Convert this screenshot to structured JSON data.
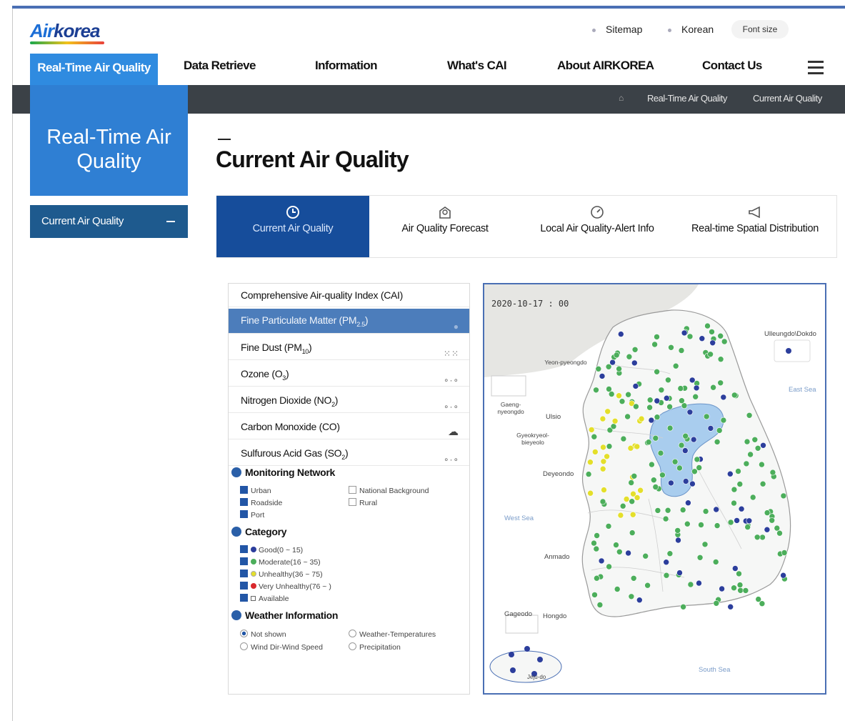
{
  "header": {
    "logo_air": "Air",
    "logo_korea": "korea",
    "sitemap": "Sitemap",
    "language": "Korean",
    "font_size": "Font size"
  },
  "nav": {
    "items": [
      "Real-Time Air Quality",
      "Data Retrieve",
      "Information",
      "What's CAI",
      "About AIRKOREA",
      "Contact Us"
    ]
  },
  "breadcrumb": [
    "Real-Time Air Quality",
    "Current Air Quality"
  ],
  "sidebar": {
    "title_line1": "Real-Time Air",
    "title_line2": "Quality",
    "item": "Current Air Quality"
  },
  "page_title": "Current Air Quality",
  "tabs": [
    {
      "label": "Current Air Quality",
      "icon": "clock-icon"
    },
    {
      "label": "Air Quality Forecast",
      "icon": "forecast-icon"
    },
    {
      "label": "Local Air Quality-Alert Info",
      "icon": "gauge-icon"
    },
    {
      "label": "Real-time Spatial Distribution",
      "icon": "megaphone-icon"
    }
  ],
  "pollutants": [
    {
      "label": "Comprehensive Air-quality Index (CAI)",
      "base": "Comprehensive Air-quality Index (CAI)",
      "sub": "",
      "tail": ""
    },
    {
      "label": "Fine Particulate Matter (PM2.5)",
      "base": "Fine Particulate Matter (PM",
      "sub": "2.5",
      "tail": ")"
    },
    {
      "label": "Fine Dust (PM10)",
      "base": "Fine Dust (PM",
      "sub": "10",
      "tail": ")"
    },
    {
      "label": "Ozone (O3)",
      "base": "Ozone (O",
      "sub": "3",
      "tail": ")"
    },
    {
      "label": "Nitrogen Dioxide (NO2)",
      "base": "Nitrogen Dioxide (NO",
      "sub": "2",
      "tail": ")"
    },
    {
      "label": "Carbon Monoxide (CO)",
      "base": "Carbon Monoxide (CO)",
      "sub": "",
      "tail": ""
    },
    {
      "label": "Sulfurous Acid Gas (SO2)",
      "base": "Sulfurous Acid Gas (SO",
      "sub": "2",
      "tail": ")"
    }
  ],
  "monitoring": {
    "title": "Monitoring Network",
    "urban": "Urban",
    "roadside": "Roadside",
    "port": "Port",
    "national_background": "National Background",
    "rural": "Rural"
  },
  "category": {
    "title": "Category",
    "good": "Good(0 ~ 15)",
    "moderate": "Moderate(16 ~ 35)",
    "unhealthy": "Unhealthy(36 ~ 75)",
    "very_unhealthy": "Very Unhealthy(76 ~ )",
    "available": "Available",
    "colors": {
      "good": "#2c3e9c",
      "moderate": "#4cae5b",
      "unhealthy": "#e4df2a",
      "very_unhealthy": "#d9282d"
    }
  },
  "weather": {
    "title": "Weather Information",
    "not_shown": "Not shown",
    "temperatures": "Weather-Temperatures",
    "wind": "Wind Dir-Wind Speed",
    "precipitation": "Precipitation"
  },
  "map": {
    "timestamp": "2020-10-17 : 00",
    "labels": {
      "ulleungdo": "Ulleungdo\\Dokdo",
      "east_sea": "East Sea",
      "yeonpyeong": "Yeon-pyeongdo",
      "gaeng": "Gaeng-nyeongdo",
      "ulsi": "Ulsio",
      "gyeokryeol": "Gyeokryeol-bieyeolo",
      "deyeondo": "Deyeondo",
      "west_sea": "West Sea",
      "anmado": "Anmado",
      "gageodo": "Gageodo",
      "hongdo": "Hongdo",
      "jejudo": "Jeju-do",
      "south_sea": "South Sea"
    }
  }
}
